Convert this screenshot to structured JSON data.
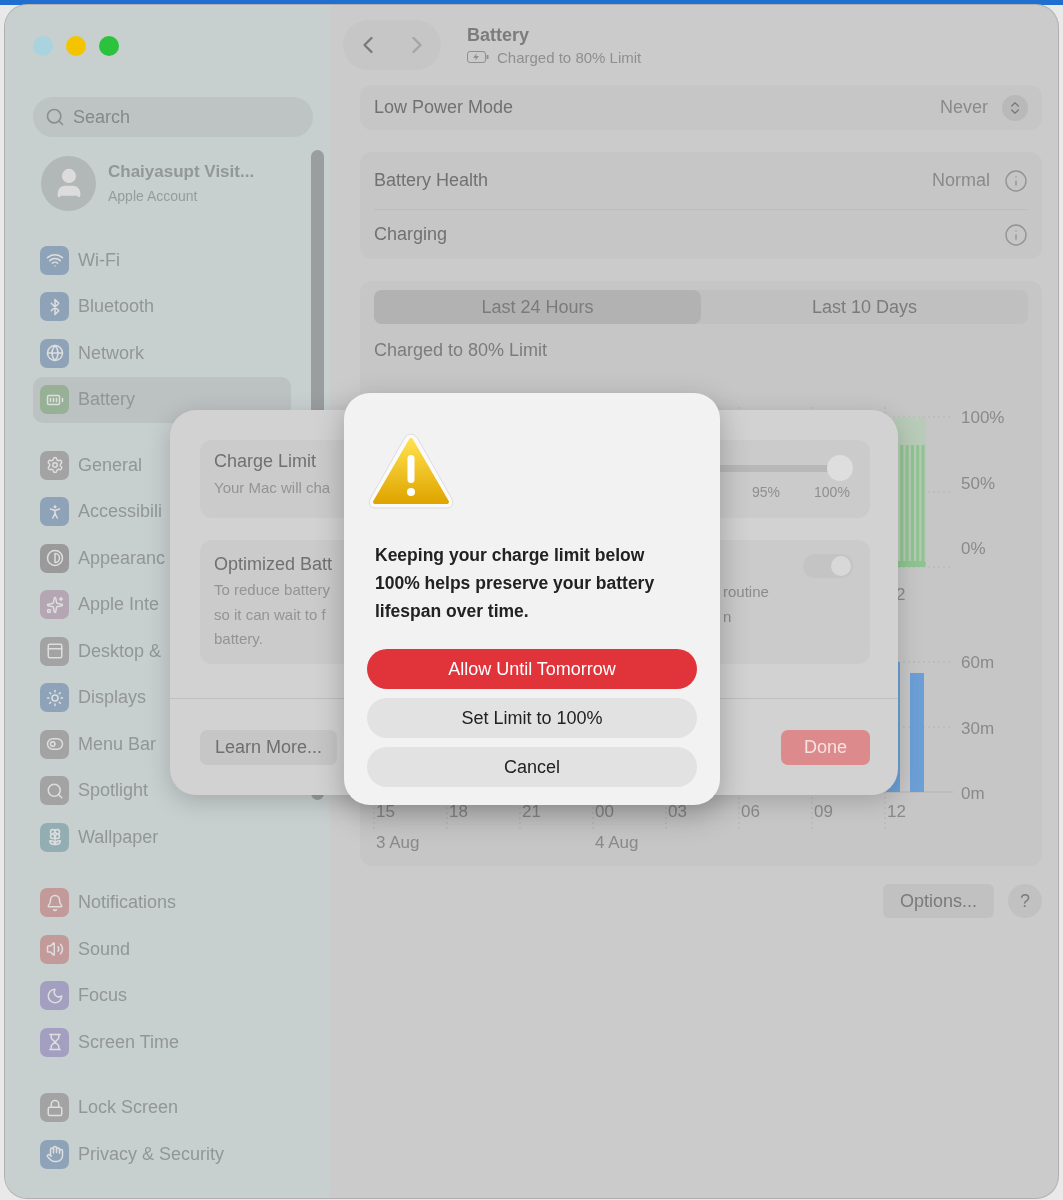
{
  "window": {
    "traffic_lights": [
      {
        "color": "#a9d3de"
      },
      {
        "color": "#f5c400"
      },
      {
        "color": "#2bc23e"
      }
    ]
  },
  "sidebar": {
    "search": {
      "placeholder": "Search"
    },
    "account": {
      "name": "Chaiyasupt Visit...",
      "subtitle": "Apple Account"
    },
    "groups": [
      {
        "items": [
          {
            "label": "Wi-Fi",
            "color": "#8ea3b8",
            "selected": false
          },
          {
            "label": "Bluetooth",
            "color": "#8ea3b8",
            "selected": false
          },
          {
            "label": "Network",
            "color": "#8ea3b8",
            "selected": false
          },
          {
            "label": "Battery",
            "color": "#97b197",
            "selected": true
          }
        ]
      },
      {
        "items": [
          {
            "label": "General",
            "color": "#a3a3a3",
            "selected": false
          },
          {
            "label": "Accessibili",
            "color": "#8ea3b8",
            "selected": false
          },
          {
            "label": "Appearanc",
            "color": "#9a9a9a",
            "selected": false
          },
          {
            "label": "Apple Inte",
            "color": "#b5a6b4",
            "selected": false
          },
          {
            "label": "Desktop &",
            "color": "#a3a3a3",
            "selected": false
          },
          {
            "label": "Displays",
            "color": "#8ea3b8",
            "selected": false
          },
          {
            "label": "Menu Bar",
            "color": "#a3a3a3",
            "selected": false
          },
          {
            "label": "Spotlight",
            "color": "#a3a3a3",
            "selected": false
          },
          {
            "label": "Wallpaper",
            "color": "#93aeb3",
            "selected": false
          }
        ]
      },
      {
        "items": [
          {
            "label": "Notifications",
            "color": "#c39a9a",
            "selected": false
          },
          {
            "label": "Sound",
            "color": "#c39a9a",
            "selected": false
          },
          {
            "label": "Focus",
            "color": "#a39fc0",
            "selected": false
          },
          {
            "label": "Screen Time",
            "color": "#a39fc0",
            "selected": false
          }
        ]
      },
      {
        "items": [
          {
            "label": "Lock Screen",
            "color": "#a3a3a3",
            "selected": false
          },
          {
            "label": "Privacy & Security",
            "color": "#8ea3b8",
            "selected": false
          }
        ]
      }
    ]
  },
  "toolbar": {
    "title": "Battery",
    "subtitle": "Charged to 80% Limit"
  },
  "low_power": {
    "label": "Low Power Mode",
    "value": "Never"
  },
  "health_rows": [
    {
      "label": "Battery Health",
      "value": "Normal"
    },
    {
      "label": "Charging"
    }
  ],
  "tabs": [
    {
      "label": "Last 24 Hours",
      "selected": true
    },
    {
      "label": "Last 10 Days",
      "selected": false
    }
  ],
  "history": {
    "caption": "Charged to 80% Limit",
    "level_ticks": [
      "100%",
      "50%",
      "0%"
    ],
    "usage_ticks": [
      "60m",
      "30m",
      "0m"
    ],
    "hours": [
      "15",
      "18",
      "21",
      "00",
      "03",
      "06",
      "09",
      "12"
    ],
    "days": [
      "3 Aug",
      "4 Aug"
    ],
    "cut_label": "2"
  },
  "footer_buttons": [
    {
      "label": "Options...",
      "kind": "pill"
    },
    {
      "label": "?",
      "kind": "round"
    }
  ],
  "sheet": {
    "charge_limit": {
      "title": "Charge Limit",
      "text": "Your Mac will cha",
      "slider": {
        "level": 1,
        "ticks": [
          "95%",
          "100%"
        ]
      }
    },
    "optimized": {
      "title": "Optimized Batt",
      "text": [
        "To reduce battery",
        "so it can wait to f",
        "battery."
      ],
      "right_text": [
        "routine",
        "n"
      ],
      "toggle": {
        "on": true,
        "disabled": true
      }
    },
    "buttons": [
      {
        "label": "Learn More...",
        "kind": "plain"
      },
      {
        "label": "Done",
        "kind": "default"
      }
    ]
  },
  "alert": {
    "message": "Keeping your charge limit below 100% helps preserve your battery lifespan over time.",
    "buttons": [
      {
        "label": "Allow Until Tomorrow",
        "kind": "destructive"
      },
      {
        "label": "Set Limit to 100%",
        "kind": "plain"
      },
      {
        "label": "Cancel",
        "kind": "plain"
      }
    ]
  }
}
